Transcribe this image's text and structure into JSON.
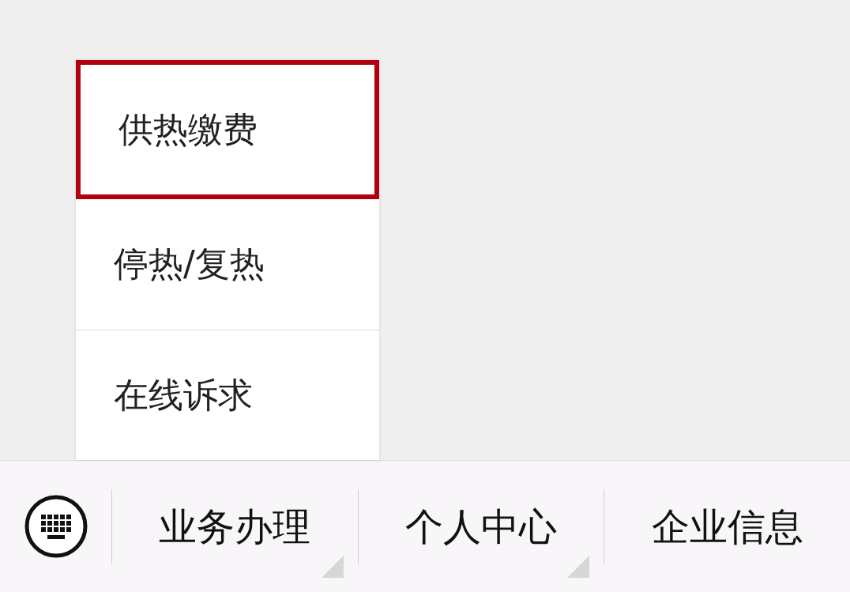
{
  "popup_menu": {
    "items": [
      {
        "label": "供热缴费",
        "highlighted": true
      },
      {
        "label": "停热/复热",
        "highlighted": false
      },
      {
        "label": "在线诉求",
        "highlighted": false
      }
    ]
  },
  "bottom_menu": {
    "items": [
      {
        "label": "业务办理",
        "has_submenu": true
      },
      {
        "label": "个人中心",
        "has_submenu": true
      },
      {
        "label": "企业信息",
        "has_submenu": false
      }
    ]
  }
}
